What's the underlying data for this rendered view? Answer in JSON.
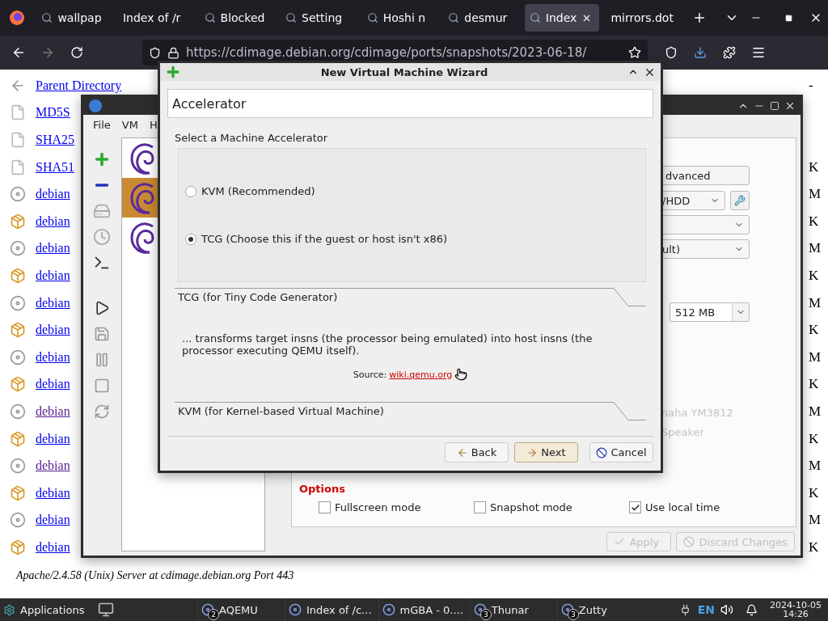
{
  "browser": {
    "tabs": [
      {
        "label": "wallpap",
        "selected": false,
        "favicon": true
      },
      {
        "label": "Index of /r",
        "selected": false,
        "favicon": false
      },
      {
        "label": "Blocked",
        "selected": false,
        "favicon": true
      },
      {
        "label": "Setting",
        "selected": false,
        "favicon": true
      },
      {
        "label": "Hoshi n",
        "selected": false,
        "favicon": true
      },
      {
        "label": "desmur",
        "selected": false,
        "favicon": true
      },
      {
        "label": "Index",
        "selected": true,
        "favicon": true
      },
      {
        "label": "mirrors.dot",
        "selected": false,
        "favicon": false
      }
    ],
    "url": "https://cdimage.debian.org/cdimage/ports/snapshots/2023-06-18/",
    "listing": [
      {
        "name": "Parent Directory",
        "kind": "parent",
        "size": "-",
        "visited": false
      },
      {
        "name": "MD5S",
        "kind": "checksum",
        "visited": false
      },
      {
        "name": "SHA25",
        "kind": "checksum",
        "visited": false
      },
      {
        "name": "SHA51",
        "kind": "checksum",
        "size": "K",
        "visited": false
      },
      {
        "name": "debian",
        "kind": "disc",
        "size": "M",
        "visited": false
      },
      {
        "name": "debian",
        "kind": "package",
        "size": "K",
        "visited": false
      },
      {
        "name": "debian",
        "kind": "disc",
        "size": "M",
        "visited": false
      },
      {
        "name": "debian",
        "kind": "package",
        "size": "K",
        "visited": false
      },
      {
        "name": "debian",
        "kind": "disc",
        "size": "M",
        "visited": false
      },
      {
        "name": "debian",
        "kind": "package",
        "size": "K",
        "visited": false
      },
      {
        "name": "debian",
        "kind": "disc",
        "size": "M",
        "visited": false
      },
      {
        "name": "debian",
        "kind": "package",
        "size": "K",
        "visited": false
      },
      {
        "name": "debian",
        "kind": "disc",
        "size": "M",
        "visited": true
      },
      {
        "name": "debian",
        "kind": "package",
        "size": "K",
        "visited": false
      },
      {
        "name": "debian",
        "kind": "disc",
        "size": "M",
        "visited": true
      },
      {
        "name": "debian",
        "kind": "package",
        "size": "K",
        "visited": false
      },
      {
        "name": "debian",
        "kind": "disc",
        "size": "M",
        "visited": false
      },
      {
        "name": "debian",
        "kind": "package",
        "size": "K",
        "visited": false
      }
    ],
    "footer": "Apache/2.4.58 (Unix) Server at cdimage.debian.org Port 443"
  },
  "aqemu": {
    "menu": [
      "File",
      "VM",
      "H"
    ],
    "vms": [
      {
        "selected": false
      },
      {
        "selected": true
      },
      {
        "selected": false
      }
    ],
    "settings": {
      "advanced": "dvanced",
      "combos": [
        {
          "value": "/HDD",
          "tool_button": true
        },
        {
          "tool_button": false
        },
        {
          "value": "ult)",
          "tool_button": false
        }
      ],
      "memory": "512 MB",
      "disabled_labels": [
        "naha YM3812",
        "Speaker"
      ],
      "options_title": "Options",
      "options": [
        {
          "label": "Fullscreen mode",
          "checked": false
        },
        {
          "label": "Snapshot mode",
          "checked": false
        },
        {
          "label": "Use local time",
          "checked": true
        }
      ],
      "buttons": [
        {
          "label": "Apply",
          "kind": "apply",
          "disabled": true
        },
        {
          "label": "Discard Changes",
          "kind": "discard",
          "disabled": true
        }
      ]
    }
  },
  "wizard": {
    "title": "New Virtual Machine Wizard",
    "page_title": "Accelerator",
    "prompt": "Select a Machine Accelerator",
    "accelerators": [
      {
        "label": "KVM (Recommended)",
        "selected": false
      },
      {
        "label": "TCG (Choose this if the guest or host isn't x86)",
        "selected": true
      }
    ],
    "sections": [
      {
        "heading": "TCG (for Tiny Code Generator)",
        "description": "... transforms target insns (the processor being emulated) into host insns (the processor executing QEMU itself).",
        "source_label": "Source:",
        "source_link": "wiki.qemu.org"
      },
      {
        "heading": "KVM (for Kernel-based Virtual Machine)"
      }
    ],
    "buttons": [
      {
        "label": "Back",
        "kind": "back",
        "focused": false
      },
      {
        "label": "Next",
        "kind": "next",
        "focused": true
      },
      {
        "label": "Cancel",
        "kind": "cancel",
        "focused": false
      }
    ]
  },
  "taskbar": {
    "start": "Applications",
    "tasks": [
      {
        "label": "AQEMU",
        "badge": "2"
      },
      {
        "label": "Index of /c..."
      },
      {
        "label": "mGBA - 0...."
      },
      {
        "label": "Thunar",
        "badge": "3"
      },
      {
        "label": "Zutty",
        "badge": "3"
      }
    ],
    "language": "EN",
    "date": "2024-10-05",
    "time": "14:26"
  }
}
